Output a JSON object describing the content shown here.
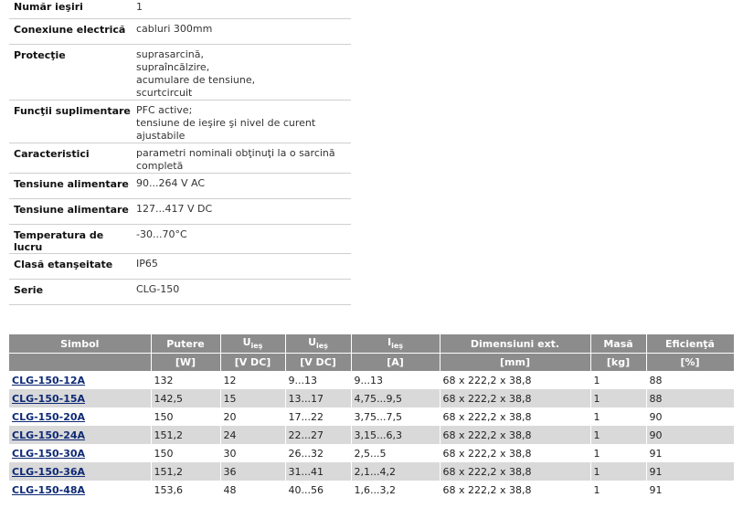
{
  "specs": [
    {
      "label": "Număr ieşiri",
      "lines": [
        "1"
      ]
    },
    {
      "label": "Conexiune electrică",
      "lines": [
        "cabluri 300mm"
      ]
    },
    {
      "label": "Protecţie",
      "lines": [
        "suprasarcină,",
        "supraîncălzire,",
        "acumulare de tensiune,",
        "scurtcircuit"
      ]
    },
    {
      "label": "Funcţii suplimentare",
      "lines": [
        "PFC active;",
        "tensiune de ieşire şi nivel de curent ajustabile"
      ]
    },
    {
      "label": "Caracteristici",
      "lines": [
        "parametri nominali obţinuţi la o sarcină completă"
      ]
    },
    {
      "label": "Tensiune alimentare",
      "lines": [
        "90...264 V AC"
      ]
    },
    {
      "label": "Tensiune alimentare",
      "lines": [
        "127...417 V DC"
      ]
    },
    {
      "label": "Temperatura de lucru",
      "lines": [
        "-30...70°C"
      ]
    },
    {
      "label": "Clasă etanşeitate",
      "lines": [
        "IP65"
      ]
    },
    {
      "label": "Serie",
      "lines": [
        "CLG-150"
      ]
    }
  ],
  "products": {
    "headers": [
      {
        "main": "Simbol",
        "sub": ""
      },
      {
        "main": "Putere",
        "sub": ""
      },
      {
        "main": "U",
        "sub": "ieş"
      },
      {
        "main": "U",
        "sub": "ieş"
      },
      {
        "main": "I",
        "sub": "ieş"
      },
      {
        "main": "Dimensiuni ext.",
        "sub": ""
      },
      {
        "main": "Masă",
        "sub": ""
      },
      {
        "main": "Eficienţă",
        "sub": ""
      }
    ],
    "units": [
      "",
      "[W]",
      "[V DC]",
      "[V DC]",
      "[A]",
      "[mm]",
      "[kg]",
      "[%]"
    ],
    "rows": [
      [
        "CLG-150-12A",
        "132",
        "12",
        "9...13",
        "9...13",
        "68 x 222,2 x 38,8",
        "1",
        "88"
      ],
      [
        "CLG-150-15A",
        "142,5",
        "15",
        "13...17",
        "4,75...9,5",
        "68 x 222,2 x 38,8",
        "1",
        "88"
      ],
      [
        "CLG-150-20A",
        "150",
        "20",
        "17...22",
        "3,75...7,5",
        "68 x 222,2 x 38,8",
        "1",
        "90"
      ],
      [
        "CLG-150-24A",
        "151,2",
        "24",
        "22...27",
        "3,15...6,3",
        "68 x 222,2 x 38,8",
        "1",
        "90"
      ],
      [
        "CLG-150-30A",
        "150",
        "30",
        "26...32",
        "2,5...5",
        "68 x 222,2 x 38,8",
        "1",
        "91"
      ],
      [
        "CLG-150-36A",
        "151,2",
        "36",
        "31...41",
        "2,1...4,2",
        "68 x 222,2 x 38,8",
        "1",
        "91"
      ],
      [
        "CLG-150-48A",
        "153,6",
        "48",
        "40...56",
        "1,6...3,2",
        "68 x 222,2 x 38,8",
        "1",
        "91"
      ]
    ]
  }
}
